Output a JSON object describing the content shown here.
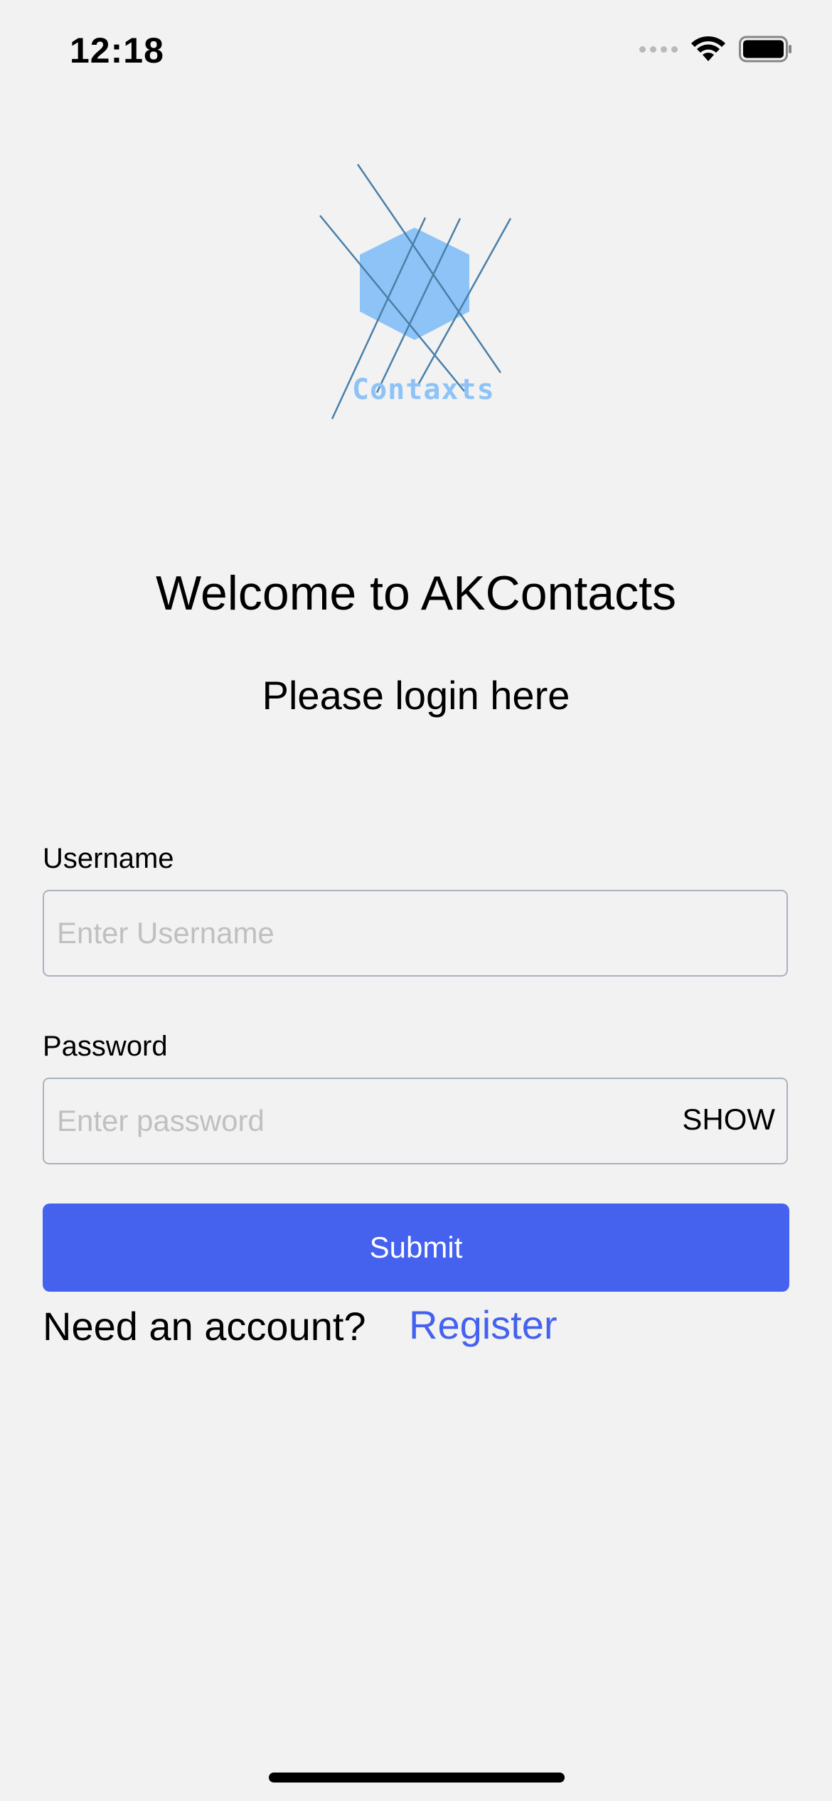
{
  "status_bar": {
    "time": "12:18"
  },
  "logo": {
    "text": "Contaxts",
    "color": "#8ec3f7",
    "line_color": "#4a7fa8"
  },
  "header": {
    "title": "Welcome to AKContacts",
    "subtitle": "Please login here"
  },
  "form": {
    "username_label": "Username",
    "username_placeholder": "Enter Username",
    "username_value": "",
    "password_label": "Password",
    "password_placeholder": "Enter password",
    "password_value": "",
    "show_label": "SHOW",
    "submit_label": "Submit"
  },
  "footer": {
    "prompt": "Need an account?",
    "register_label": "Register"
  },
  "colors": {
    "accent": "#4562ef",
    "background": "#f2f2f2"
  }
}
